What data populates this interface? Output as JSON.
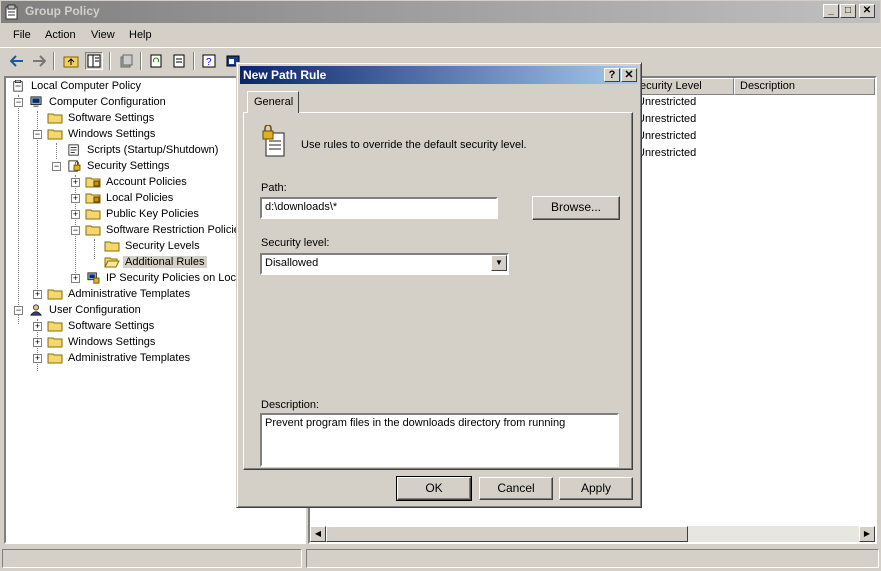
{
  "window": {
    "title": "Group Policy"
  },
  "menu": [
    "File",
    "Action",
    "View",
    "Help"
  ],
  "tree": [
    {
      "label": "Local Computer Policy",
      "icon": "policy-icon"
    },
    {
      "label": "Computer Configuration",
      "icon": "computer-icon"
    },
    {
      "label": "Software Settings",
      "icon": "folder-icon"
    },
    {
      "label": "Windows Settings",
      "icon": "folder-icon"
    },
    {
      "label": "Scripts (Startup/Shutdown)",
      "icon": "script-icon"
    },
    {
      "label": "Security Settings",
      "icon": "security-icon"
    },
    {
      "label": "Account Policies",
      "icon": "folder-icon"
    },
    {
      "label": "Local Policies",
      "icon": "folder-icon"
    },
    {
      "label": "Public Key Policies",
      "icon": "folder-icon"
    },
    {
      "label": "Software Restriction Policie",
      "icon": "folder-icon"
    },
    {
      "label": "Security Levels",
      "icon": "folder-icon"
    },
    {
      "label": "Additional Rules",
      "icon": "folder-open-icon"
    },
    {
      "label": "IP Security Policies on Local",
      "icon": "ipsec-icon"
    },
    {
      "label": "Administrative Templates",
      "icon": "folder-icon"
    },
    {
      "label": "User Configuration",
      "icon": "user-icon"
    },
    {
      "label": "Software Settings",
      "icon": "folder-icon"
    },
    {
      "label": "Windows Settings",
      "icon": "folder-icon"
    },
    {
      "label": "Administrative Templates",
      "icon": "folder-icon"
    }
  ],
  "list": {
    "columns": [
      "ecurity Level",
      "Description"
    ],
    "rows": [
      "Unrestricted",
      "Unrestricted",
      "Unrestricted",
      "Unrestricted"
    ]
  },
  "dialog": {
    "title": "New Path Rule",
    "help_btn": "?",
    "close_btn": "✕",
    "tab": "General",
    "intro": "Use rules to override the default security level.",
    "path_label": "Path:",
    "path_value": "d:\\downloads\\*",
    "browse": "Browse...",
    "security_label": "Security level:",
    "security_value": "Disallowed",
    "description_label": "Description:",
    "description_value": "Prevent program files in the downloads directory from running",
    "ok": "OK",
    "cancel": "Cancel",
    "apply": "Apply"
  }
}
